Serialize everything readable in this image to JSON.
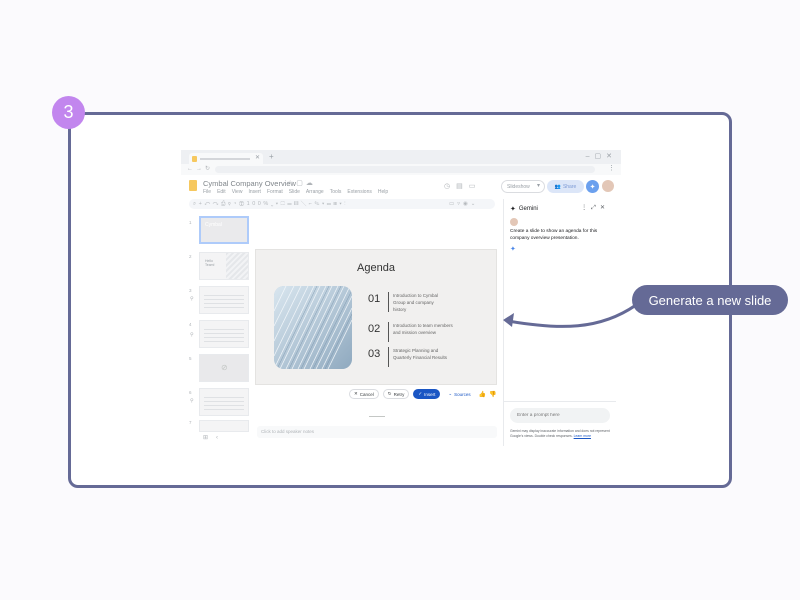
{
  "step_badge": "3",
  "callout": {
    "label": "Generate a new slide"
  },
  "colors": {
    "accent": "#656a96",
    "badge": "#c286ee",
    "primary_button": "#1a56c4",
    "share": "#dce6f8"
  },
  "doc": {
    "title": "Cymbal Company Overview",
    "menu": [
      "File",
      "Edit",
      "View",
      "Insert",
      "Format",
      "Slide",
      "Arrange",
      "Tools",
      "Extensions",
      "Help"
    ],
    "slideshow_label": "Slideshow",
    "share_label": "Share"
  },
  "filmstrip": {
    "slides": [
      {
        "num": "1",
        "text": "Cymbal"
      },
      {
        "num": "2",
        "text": "Hello\nTeam!"
      },
      {
        "num": "3",
        "text": ""
      },
      {
        "num": "4",
        "text": ""
      },
      {
        "num": "5",
        "text": ""
      },
      {
        "num": "6",
        "text": ""
      },
      {
        "num": "7",
        "text": ""
      }
    ]
  },
  "slide": {
    "title": "Agenda",
    "items": [
      {
        "num": "01",
        "text": "Introduction to Cymbal\nGroup and company\nhistory"
      },
      {
        "num": "02",
        "text": "Introduction to team members\nand mission overview"
      },
      {
        "num": "03",
        "text": "Strategic Planning and\nQuarterly Financial Results"
      }
    ]
  },
  "actions": {
    "cancel": "Cancel",
    "retry": "Retry",
    "insert": "Insert",
    "sources": "Sources"
  },
  "speaker_notes": "Click to add speaker notes",
  "gemini": {
    "title": "Gemini",
    "user_prompt": "Create a slide to show an agenda for this company overview presentation.",
    "input_placeholder": "Enter a prompt here",
    "disclaimer": "Gemini may display inaccurate information and does not represent Google's views. Double check responses.",
    "learn_more": "Learn more"
  }
}
